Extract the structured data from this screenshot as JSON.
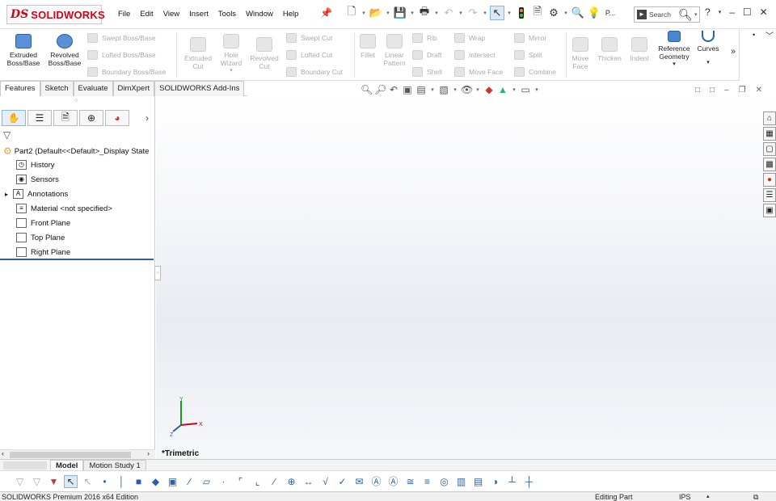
{
  "app": {
    "logo_mark": "DS",
    "logo_text": "SOLIDWORKS"
  },
  "menu": [
    "File",
    "Edit",
    "View",
    "Insert",
    "Tools",
    "Window",
    "Help"
  ],
  "search": {
    "label": "Search"
  },
  "features_tools": {
    "extruded_boss": "Extruded Boss/Base",
    "revolved_boss": "Revolved Boss/Base",
    "swept_boss": "Swept Boss/Base",
    "lofted_boss": "Lofted Boss/Base",
    "boundary_boss": "Boundary Boss/Base",
    "extruded_cut": "Extruded Cut",
    "hole_wizard": "Hole Wizard",
    "revolved_cut": "Revolved Cut",
    "swept_cut": "Swept Cut",
    "lofted_cut": "Lofted Cut",
    "boundary_cut": "Boundary Cut",
    "fillet": "Fillet",
    "linear_pattern": "Linear Pattern",
    "rib": "Rib",
    "wrap": "Wrap",
    "draft": "Draft",
    "intersect": "Intersect",
    "shell": "Shell",
    "mirror": "Mirror",
    "split": "Split",
    "combine": "Combine",
    "move_face_small": "Move Face",
    "move_face": "Move Face",
    "thicken": "Thicken",
    "indent": "Indent",
    "reference_geometry": "Reference Geometry",
    "curves": "Curves"
  },
  "cmd_tabs": [
    "Features",
    "Sketch",
    "Evaluate",
    "DimXpert",
    "SOLIDWORKS Add-Ins"
  ],
  "tree": {
    "root": "Part2  (Default<<Default>_Display State",
    "items": [
      "History",
      "Sensors",
      "Annotations",
      "Material <not specified>",
      "Front Plane",
      "Top Plane",
      "Right Plane"
    ]
  },
  "viewport": {
    "view_name": "*Trimetric",
    "triad": {
      "x": "X",
      "y": "Y",
      "z": "Z"
    }
  },
  "bottom_tabs": [
    "Model",
    "Motion Study 1"
  ],
  "status": {
    "product": "SOLIDWORKS Premium 2016 x64 Edition",
    "mode": "Editing Part",
    "units": "IPS"
  },
  "colors": {
    "brand": "#d0021b",
    "accent": "#2b5fa6"
  }
}
